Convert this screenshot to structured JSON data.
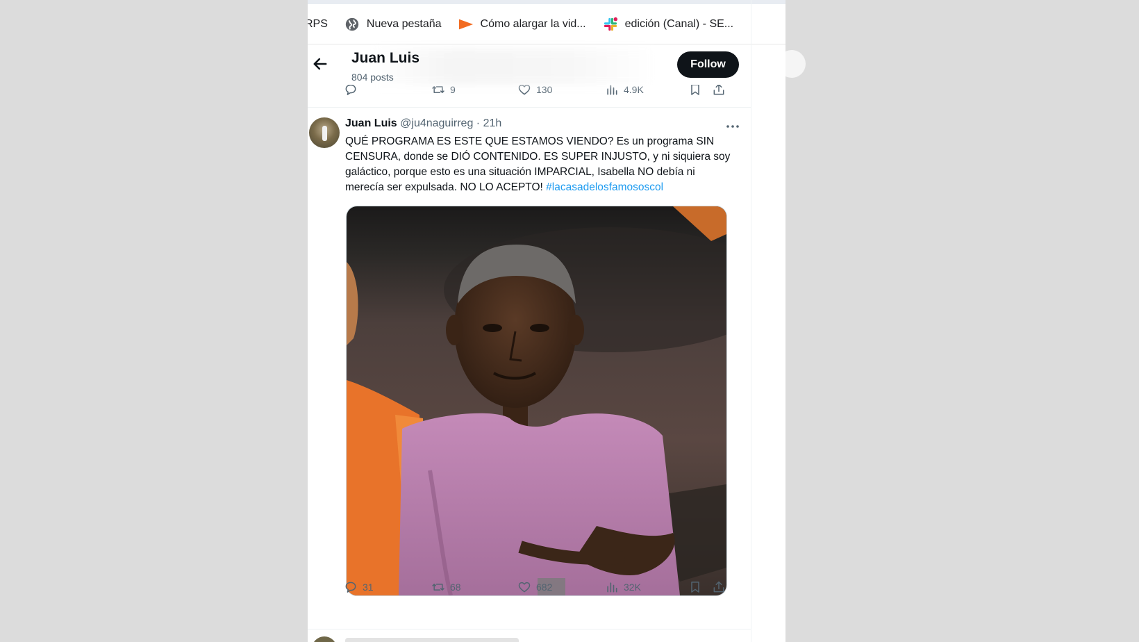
{
  "bookmarks": [
    {
      "label": "RPS",
      "icon": "none"
    },
    {
      "label": "Nueva pestaña",
      "icon": "globe-icon"
    },
    {
      "label": "Cómo alargar la vid...",
      "icon": "play-flag-icon"
    },
    {
      "label": "edición (Canal) - SE...",
      "icon": "slack-icon"
    }
  ],
  "header": {
    "title": "Juan Luis",
    "posts_count": "804 posts",
    "follow_label": "Follow"
  },
  "prev_tweet": {
    "actions": {
      "replies": "",
      "reposts": "9",
      "likes": "130",
      "views": "4.9K"
    }
  },
  "tweet": {
    "name": "Juan Luis",
    "handle": "@ju4naguirreg",
    "separator": "·",
    "time": "21h",
    "text": "QUÉ PROGRAMA ES ESTE QUE ESTAMOS VIENDO? Es un programa SIN CENSURA, donde se DIÓ CONTENIDO. ES SUPER INJUSTO, y ni siquiera soy galáctico, porque esto es una situación IMPARCIAL, Isabella NO debía ni merecía ser expulsada. NO LO ACEPTO! ",
    "hashtag": "#lacasadelosfamososcol",
    "actions": {
      "replies": "31",
      "reposts": "68",
      "likes": "682",
      "views": "32K"
    }
  },
  "colors": {
    "accent": "#1d9bf0",
    "text": "#0f1419",
    "muted": "#536471",
    "follow_bg": "#0f1419"
  }
}
